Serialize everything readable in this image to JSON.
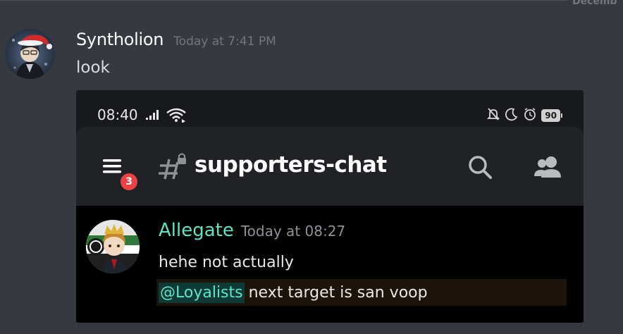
{
  "header": {
    "date_divider": "Decemb"
  },
  "message": {
    "author": "Syntholion",
    "timestamp": "Today at 7:41 PM",
    "text": "look"
  },
  "screenshot": {
    "status_bar": {
      "time": "08:40",
      "battery": "90",
      "icons": [
        "signal-icon",
        "wifi-icon",
        "mute-icon",
        "moon-icon",
        "alarm-icon",
        "battery-icon"
      ]
    },
    "app_bar": {
      "channel": "supporters-chat",
      "unread_badge": "3",
      "icons": [
        "hamburger-menu-icon",
        "locked-channel-icon",
        "search-icon",
        "members-icon"
      ]
    },
    "chat_message": {
      "author": "Allegate",
      "timestamp": "Today at 08:27",
      "line1": "hehe not actually",
      "mention": "@Loyalists",
      "line2": "next target is san voop"
    }
  },
  "colors": {
    "background": "#36393f",
    "inner_author": "#5fe3c4",
    "badge": "#ed4245",
    "mention_bg": "#0d3a37"
  }
}
